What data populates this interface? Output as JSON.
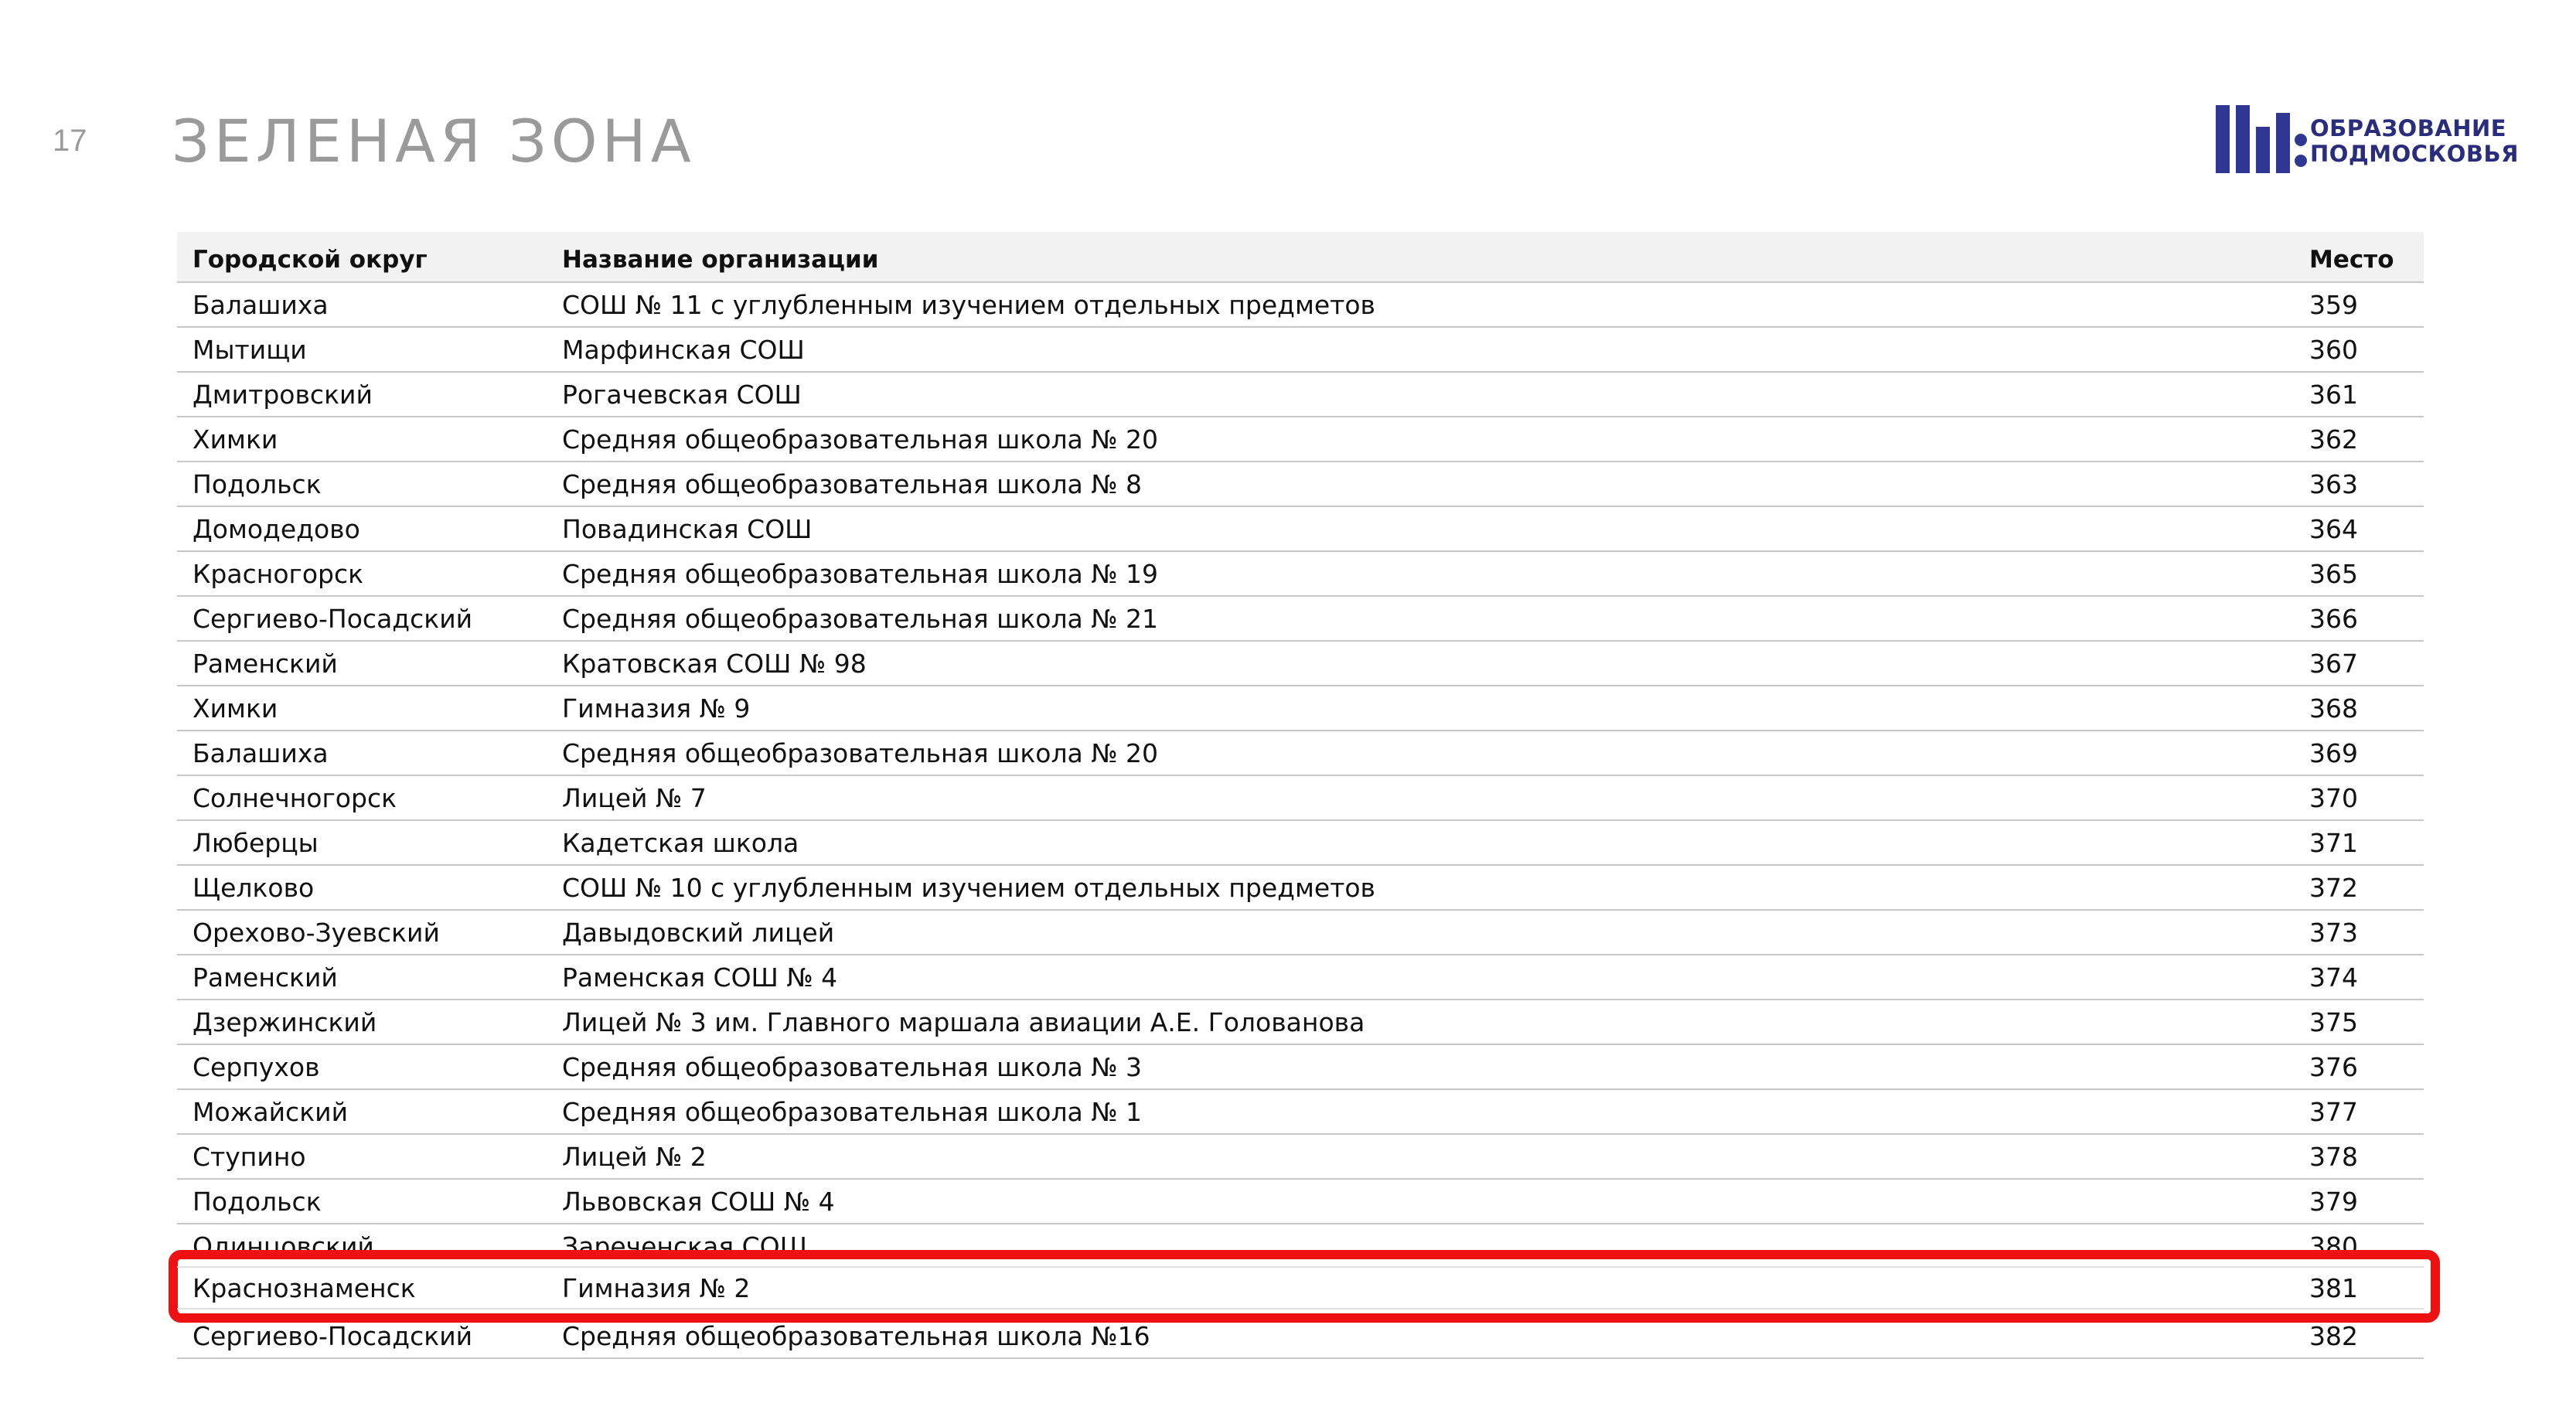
{
  "header": {
    "page_number": "17",
    "title": "ЗЕЛЕНАЯ ЗОНА"
  },
  "logo": {
    "line1": "ОБРАЗОВАНИЕ",
    "line2": "ПОДМОСКОВЬЯ",
    "color": "#2a2d7c"
  },
  "table": {
    "columns": {
      "district": "Городской округ",
      "org": "Название организации",
      "place": "Место"
    },
    "rows": [
      {
        "district": "Балашиха",
        "org": "СОШ № 11 с углубленным изучением отдельных предметов",
        "place": "359"
      },
      {
        "district": "Мытищи",
        "org": "Марфинская СОШ",
        "place": "360"
      },
      {
        "district": "Дмитровский",
        "org": "Рогачевская СОШ",
        "place": "361"
      },
      {
        "district": "Химки",
        "org": "Средняя общеобразовательная школа № 20",
        "place": "362"
      },
      {
        "district": "Подольск",
        "org": "Средняя общеобразовательная школа № 8",
        "place": "363"
      },
      {
        "district": "Домодедово",
        "org": "Повадинская СОШ",
        "place": "364"
      },
      {
        "district": "Красногорск",
        "org": "Средняя общеобразовательная школа № 19",
        "place": "365"
      },
      {
        "district": "Сергиево-Посадский",
        "org": "Средняя общеобразовательная школа № 21",
        "place": "366"
      },
      {
        "district": "Раменский",
        "org": "Кратовская СОШ № 98",
        "place": "367"
      },
      {
        "district": "Химки",
        "org": "Гимназия № 9",
        "place": "368"
      },
      {
        "district": "Балашиха",
        "org": "Средняя общеобразовательная школа № 20",
        "place": "369"
      },
      {
        "district": "Солнечногорск",
        "org": "Лицей № 7",
        "place": "370"
      },
      {
        "district": "Люберцы",
        "org": "Кадетская школа",
        "place": "371"
      },
      {
        "district": "Щелково",
        "org": "СОШ № 10 с углубленным изучением отдельных предметов",
        "place": "372"
      },
      {
        "district": "Орехово-Зуевский",
        "org": "Давыдовский лицей",
        "place": "373"
      },
      {
        "district": "Раменский",
        "org": "Раменская СОШ № 4",
        "place": "374"
      },
      {
        "district": "Дзержинский",
        "org": "Лицей № 3 им. Главного маршала авиации А.Е. Голованова",
        "place": "375"
      },
      {
        "district": "Серпухов",
        "org": "Средняя общеобразовательная школа № 3",
        "place": "376"
      },
      {
        "district": "Можайский",
        "org": "Средняя общеобразовательная школа № 1",
        "place": "377"
      },
      {
        "district": "Ступино",
        "org": "Лицей № 2",
        "place": "378"
      },
      {
        "district": "Подольск",
        "org": "Львовская СОШ № 4",
        "place": "379"
      },
      {
        "district": "Одинцовский",
        "org": "Зареченская СОШ",
        "place": "380"
      },
      {
        "district": "Краснознаменск",
        "org": "Гимназия № 2",
        "place": "381"
      },
      {
        "district": "Сергиево-Посадский",
        "org": "Средняя общеобразовательная школа №16",
        "place": "382"
      }
    ],
    "highlight": {
      "district": "Краснознаменск",
      "org": "Гимназия № 2",
      "place": "381",
      "color": "#ee1111"
    }
  }
}
